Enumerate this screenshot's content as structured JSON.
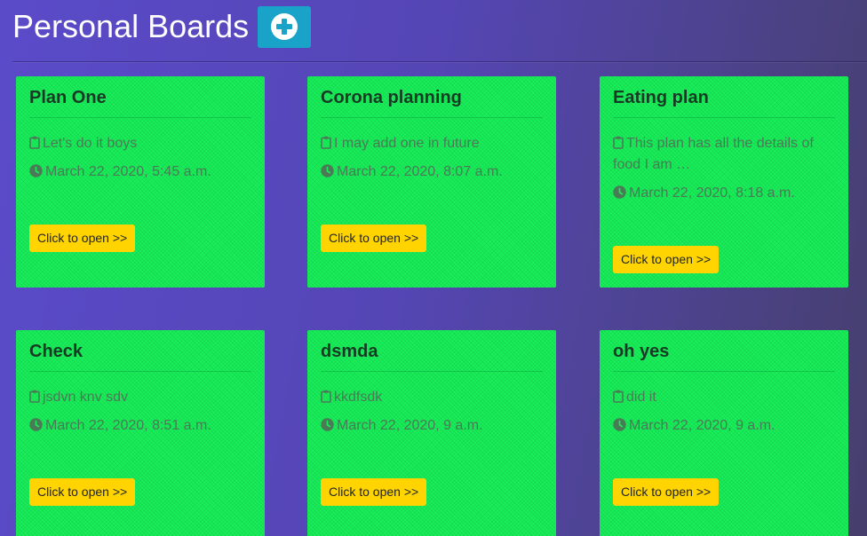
{
  "header": {
    "title": "Personal Boards",
    "add_icon": "plus-circle-icon"
  },
  "boards": [
    {
      "title": "Plan One",
      "description": "Let's do it boys",
      "date": "March 22, 2020, 5:45 a.m.",
      "open_label": "Click to open >>"
    },
    {
      "title": "Corona planning",
      "description": "I may add one in future",
      "date": "March 22, 2020, 8:07 a.m.",
      "open_label": "Click to open >>"
    },
    {
      "title": "Eating plan",
      "description": "This plan has all the details of food I am …",
      "date": "March 22, 2020, 8:18 a.m.",
      "open_label": "Click to open >>"
    },
    {
      "title": "Check",
      "description": "jsdvn knv sdv",
      "date": "March 22, 2020, 8:51 a.m.",
      "open_label": "Click to open >>"
    },
    {
      "title": "dsmda",
      "description": "kkdfsdk",
      "date": "March 22, 2020, 9 a.m.",
      "open_label": "Click to open >>"
    },
    {
      "title": "oh yes",
      "description": "did it",
      "date": "March 22, 2020, 9 a.m.",
      "open_label": "Click to open >>"
    }
  ],
  "icons": {
    "description": "clipboard-icon",
    "date": "clock-icon"
  },
  "colors": {
    "card_bg": "#19f05a",
    "open_button": "#ffd400",
    "add_button": "#1aa3c9"
  }
}
